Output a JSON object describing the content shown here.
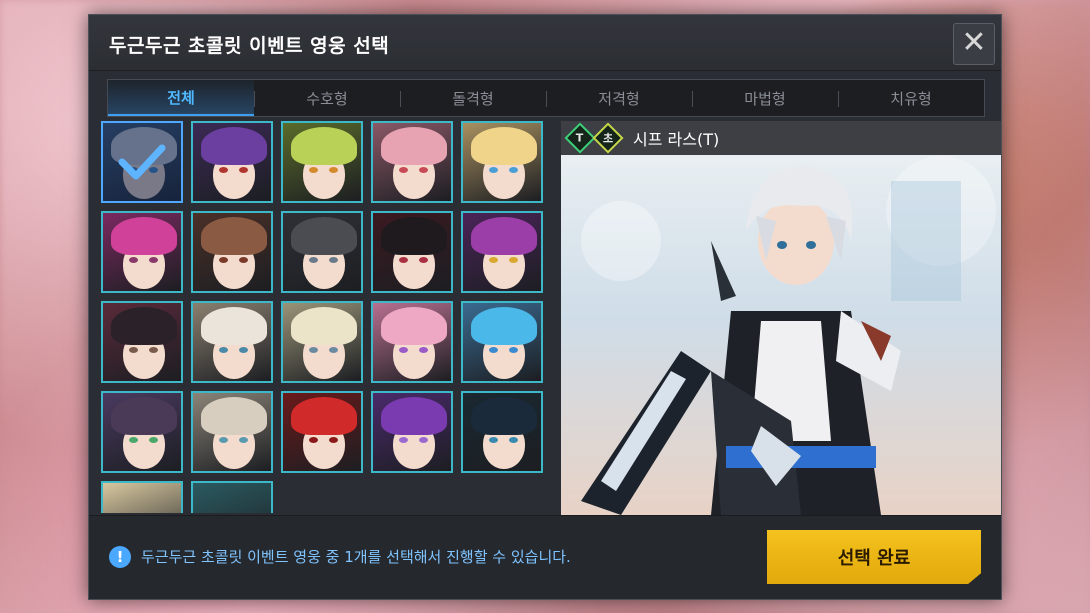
{
  "dialog": {
    "title": "두근두근 초콜릿 이벤트 영웅 선택",
    "close_icon": "close-icon"
  },
  "tabs": [
    {
      "label": "전체",
      "active": true
    },
    {
      "label": "수호형",
      "active": false
    },
    {
      "label": "돌격형",
      "active": false
    },
    {
      "label": "저격형",
      "active": false
    },
    {
      "label": "마법형",
      "active": false
    },
    {
      "label": "치유형",
      "active": false
    }
  ],
  "heroes": [
    {
      "hair": "#c9ccd3",
      "eye": "#3f86c9",
      "bg": "#3c5a7a",
      "selected": true
    },
    {
      "hair": "#6a3fa0",
      "eye": "#b0352f",
      "bg": "#3b2a55",
      "selected": false
    },
    {
      "hair": "#b9d157",
      "eye": "#d48a2c",
      "bg": "#5a6b2a",
      "selected": false
    },
    {
      "hair": "#e8a3b3",
      "eye": "#c84a55",
      "bg": "#8a5866",
      "selected": false
    },
    {
      "hair": "#f0d48a",
      "eye": "#4a9ed6",
      "bg": "#a89060",
      "selected": false
    },
    {
      "hair": "#d0429a",
      "eye": "#8a3a6a",
      "bg": "#7a2a60",
      "selected": false
    },
    {
      "hair": "#8a5a42",
      "eye": "#7a3a2a",
      "bg": "#4a3028",
      "selected": false
    },
    {
      "hair": "#4a4c52",
      "eye": "#6a7a8a",
      "bg": "#2e3036",
      "selected": false
    },
    {
      "hair": "#1e1a1e",
      "eye": "#a83040",
      "bg": "#3a1a20",
      "selected": false
    },
    {
      "hair": "#9c3ea8",
      "eye": "#d8a830",
      "bg": "#4a2458",
      "selected": false
    },
    {
      "hair": "#2a2228",
      "eye": "#7a5a4a",
      "bg": "#5a2a3a",
      "selected": false
    },
    {
      "hair": "#eae4da",
      "eye": "#4a8aa8",
      "bg": "#8a8070",
      "selected": false
    },
    {
      "hair": "#ece4c8",
      "eye": "#6a8aa0",
      "bg": "#9a9478",
      "selected": false
    },
    {
      "hair": "#eea8c4",
      "eye": "#9a5ac8",
      "bg": "#b87090",
      "selected": false
    },
    {
      "hair": "#4ab8e8",
      "eye": "#3a8ad0",
      "bg": "#3a6a90",
      "selected": false
    },
    {
      "hair": "#4a3a58",
      "eye": "#4aa86a",
      "bg": "#4a3a60",
      "selected": false
    },
    {
      "hair": "#d8cec0",
      "eye": "#5a9ab0",
      "bg": "#8a8478",
      "selected": false
    },
    {
      "hair": "#d02a2a",
      "eye": "#8a1a1a",
      "bg": "#6a1a1a",
      "selected": false
    },
    {
      "hair": "#7a3ab0",
      "eye": "#9a6ad0",
      "bg": "#4a2a6a",
      "selected": false
    },
    {
      "hair": "#1a2a3a",
      "eye": "#3a8ab0",
      "bg": "#1a2830",
      "selected": false
    }
  ],
  "selected_hero": {
    "name": "시프 라스(T)",
    "badges": [
      "T",
      "초"
    ]
  },
  "footer": {
    "info_icon": "info-icon",
    "info_text": "두근두근 초콜릿 이벤트 영웅 중 1개를 선택해서 진행할 수 있습니다.",
    "confirm_label": "선택 완료"
  }
}
